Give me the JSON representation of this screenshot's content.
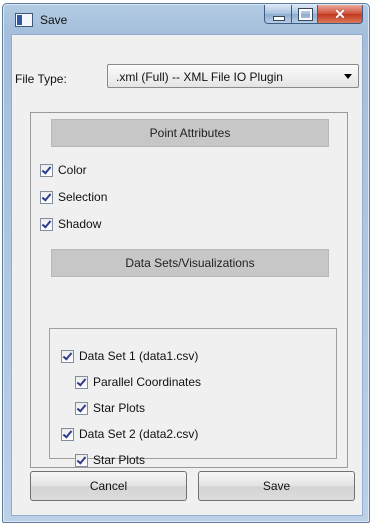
{
  "window": {
    "title": "Save",
    "caption_buttons": {
      "minimize": "minimize-icon",
      "maximize": "maximize-icon",
      "close": "close-icon"
    }
  },
  "file_type": {
    "label": "File Type:",
    "selected": ".xml (Full) -- XML File IO Plugin"
  },
  "point_attributes": {
    "header": "Point Attributes",
    "items": [
      {
        "label": "Color",
        "checked": true
      },
      {
        "label": "Selection",
        "checked": true
      },
      {
        "label": "Shadow",
        "checked": true
      }
    ]
  },
  "data_sets": {
    "header": "Data Sets/Visualizations",
    "items": [
      {
        "label": "Data Set 1 (data1.csv)",
        "checked": true,
        "level": 0
      },
      {
        "label": "Parallel Coordinates",
        "checked": true,
        "level": 1
      },
      {
        "label": "Star Plots",
        "checked": true,
        "level": 1
      },
      {
        "label": "Data Set 2 (data2.csv)",
        "checked": true,
        "level": 0
      },
      {
        "label": "Star Plots",
        "checked": true,
        "level": 1
      }
    ]
  },
  "buttons": {
    "cancel": "Cancel",
    "save": "Save"
  },
  "colors": {
    "title_bar": "#a4bedb",
    "close_button": "#c3371f",
    "section_header": "#c7c7c7",
    "check_mark": "#2d3c8c"
  }
}
